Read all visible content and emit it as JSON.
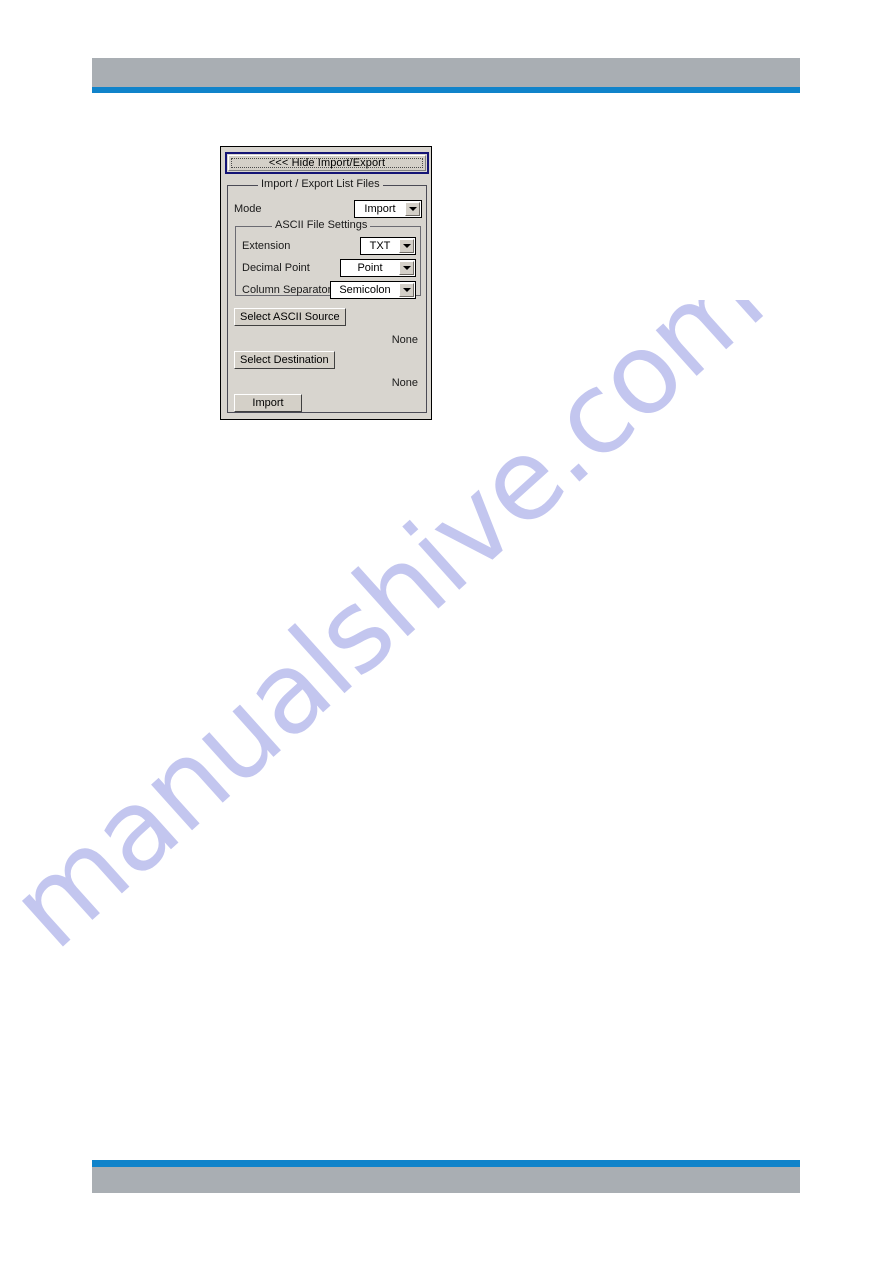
{
  "page": {
    "header_bar_color": "#a9aeb3",
    "accent_color": "#1083ca",
    "watermark_text": "manualshive.com",
    "watermark_color": "#c3c6ef"
  },
  "dialog": {
    "hide_button_label": "<<< Hide Import/Export",
    "group_title": "Import / Export List Files",
    "mode": {
      "label": "Mode",
      "value": "Import"
    },
    "ascii_group": {
      "title": "ASCII File Settings",
      "rows": [
        {
          "label": "Extension",
          "value": "TXT"
        },
        {
          "label": "Decimal Point",
          "value": "Point"
        },
        {
          "label": "Column Separator",
          "value": "Semicolon"
        }
      ]
    },
    "select_ascii_source": {
      "button_label": "Select ASCII Source",
      "value": "None"
    },
    "select_destination": {
      "button_label": "Select Destination",
      "value": "None"
    },
    "action_button_label": "Import"
  }
}
